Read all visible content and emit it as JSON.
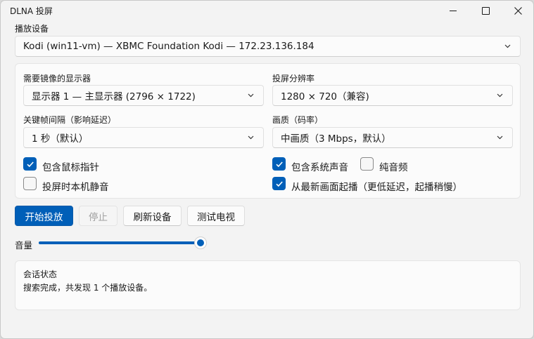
{
  "window": {
    "title": "DLNA 投屏"
  },
  "device": {
    "label": "播放设备",
    "selected": "Kodi (win11-vm) — XBMC Foundation Kodi — 172.23.136.184"
  },
  "settings": {
    "display": {
      "label": "需要镜像的显示器",
      "selected": "显示器 1 — 主显示器 (2796 × 1722)"
    },
    "resolution": {
      "label": "投屏分辨率",
      "selected": "1280 × 720（兼容)"
    },
    "keyframe": {
      "label": "关键帧间隔（影响延迟）",
      "selected": "1 秒（默认）"
    },
    "quality": {
      "label": "画质（码率）",
      "selected": "中画质（3 Mbps，默认）"
    },
    "checkboxes": {
      "cursor": {
        "label": "包含鼠标指针",
        "checked": true
      },
      "system_audio": {
        "label": "包含系统声音",
        "checked": true
      },
      "audio_only": {
        "label": "纯音频",
        "checked": false
      },
      "mute_local": {
        "label": "投屏时本机静音",
        "checked": false
      },
      "latest_frame": {
        "label": "从最新画面起播（更低延迟，起播稍慢）",
        "checked": true
      }
    }
  },
  "actions": {
    "start": "开始投放",
    "stop": "停止",
    "refresh": "刷新设备",
    "test_tv": "测试电视"
  },
  "volume": {
    "label": "音量",
    "level_percent": 100
  },
  "session": {
    "title": "会话状态",
    "message": "搜索完成，共发现 1 个播放设备。"
  },
  "colors": {
    "accent": "#005fb8",
    "window_bg": "#f3f3f3",
    "card_bg": "#fbfbfb"
  }
}
